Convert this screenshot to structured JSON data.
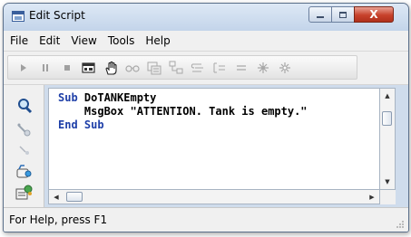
{
  "window": {
    "title": "Edit Script",
    "close_glyph": "X"
  },
  "menu": [
    "File",
    "Edit",
    "View",
    "Tools",
    "Help"
  ],
  "toolbar": {
    "buttons": [
      "run-icon",
      "pause-icon",
      "stop-icon",
      "dialog-editor-icon",
      "hand-icon",
      "glasses-icon",
      "object-browser-icon",
      "call-stack-icon",
      "step-into-icon",
      "step-over-icon",
      "step-out-icon",
      "breakpoint-icon",
      "clear-breakpoints-icon"
    ]
  },
  "sidebar": {
    "icons": [
      "find-icon",
      "pick-property-icon",
      "pick-method-icon",
      "pick-object-icon",
      "object-browser-icon"
    ]
  },
  "code": {
    "line1_keyword": "Sub",
    "line1_name": " DoTANKEmpty",
    "line2": "    MsgBox \"ATTENTION. Tank is empty.\"",
    "line3_keyword": "End Sub"
  },
  "status": {
    "text": "For Help, press F1"
  },
  "colors": {
    "keyword": "#1e3fa8",
    "close_button": "#c7412b",
    "titlebar": "#cfdcec"
  }
}
